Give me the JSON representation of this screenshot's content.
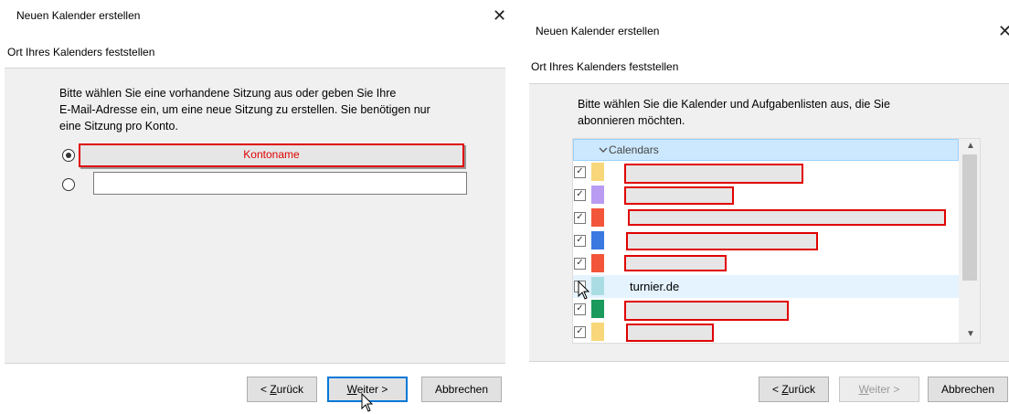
{
  "left_dialog": {
    "title": "Neuen Kalender erstellen",
    "subtitle": "Ort Ihres Kalenders feststellen",
    "instruction_lines": [
      "Bitte wählen Sie eine vorhandene Sitzung aus oder geben Sie Ihre",
      "E-Mail-Adresse ein, um eine neue Sitzung zu erstellen. Sie benötigen nur",
      "eine Sitzung pro Konto."
    ],
    "session_label": "Kontoname",
    "email_value": "",
    "buttons": {
      "back": "< Zurück",
      "next": "Weiter >",
      "cancel": "Abbrechen"
    }
  },
  "right_dialog": {
    "title": "Neuen Kalender erstellen",
    "subtitle": "Ort Ihres Kalenders feststellen",
    "instruction_lines": [
      "Bitte wählen Sie die Kalender und Aufgabenlisten aus, die Sie",
      "abonnieren möchten."
    ],
    "group_label": "Calendars",
    "calendars": [
      {
        "color": "#f7d77a",
        "checked": true,
        "name": ""
      },
      {
        "color": "#b99cf2",
        "checked": true,
        "name": ""
      },
      {
        "color": "#f2553a",
        "checked": true,
        "name": ""
      },
      {
        "color": "#3b78e0",
        "checked": true,
        "name": ""
      },
      {
        "color": "#f2553a",
        "checked": true,
        "name": ""
      },
      {
        "color": "#a9dde3",
        "checked": false,
        "name": "turnier.de"
      },
      {
        "color": "#1a9a5c",
        "checked": true,
        "name": ""
      },
      {
        "color": "#f7d77a",
        "checked": true,
        "name": ""
      }
    ],
    "buttons": {
      "back": "< Zurück",
      "next": "Weiter >",
      "cancel": "Abbrechen"
    }
  }
}
